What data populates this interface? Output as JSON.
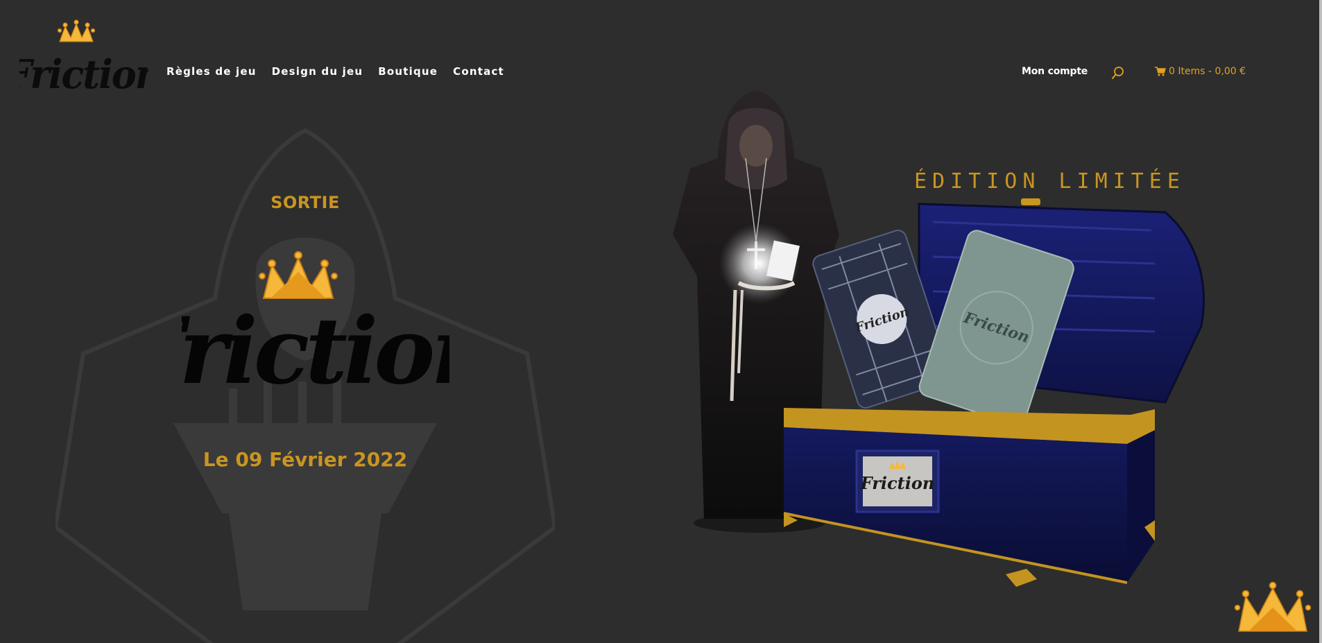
{
  "site": {
    "logo_alt": "Friction",
    "nav": [
      {
        "label": "Règles de jeu"
      },
      {
        "label": "Design du jeu"
      },
      {
        "label": "Boutique"
      },
      {
        "label": "Contact"
      }
    ],
    "account_label": "Mon compte",
    "cart_label": "0 Items - 0,00 €"
  },
  "hero": {
    "kicker": "SORTIE",
    "logo_text": "Friction",
    "date": "Le 09 Février 2022",
    "limited_edition": "ÉDITION LIMITÉE"
  },
  "colors": {
    "background": "#2d2d2d",
    "gold": "#c99522",
    "crown": "#f5b83a",
    "chest_blue": "#1a1f6b"
  },
  "icons": {
    "search": "search-icon",
    "cart": "cart-icon",
    "crown": "crown-icon"
  }
}
